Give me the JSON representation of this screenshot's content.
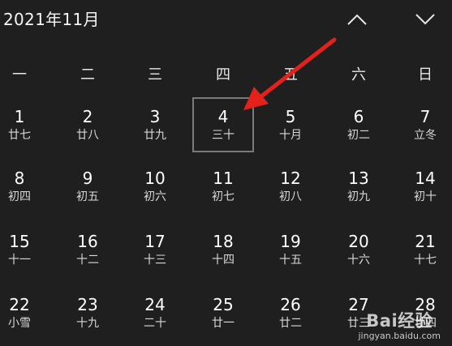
{
  "header": {
    "title": "2021年11月",
    "prev_icon": "chevron-up-icon",
    "next_icon": "chevron-down-icon"
  },
  "weekdays": [
    "一",
    "二",
    "三",
    "四",
    "五",
    "六",
    "日"
  ],
  "days": [
    {
      "solar": "1",
      "lunar": "廿七"
    },
    {
      "solar": "2",
      "lunar": "廿八"
    },
    {
      "solar": "3",
      "lunar": "廿九"
    },
    {
      "solar": "4",
      "lunar": "三十",
      "today": true
    },
    {
      "solar": "5",
      "lunar": "十月"
    },
    {
      "solar": "6",
      "lunar": "初二"
    },
    {
      "solar": "7",
      "lunar": "立冬"
    },
    {
      "solar": "8",
      "lunar": "初四"
    },
    {
      "solar": "9",
      "lunar": "初五"
    },
    {
      "solar": "10",
      "lunar": "初六"
    },
    {
      "solar": "11",
      "lunar": "初七"
    },
    {
      "solar": "12",
      "lunar": "初八"
    },
    {
      "solar": "13",
      "lunar": "初九"
    },
    {
      "solar": "14",
      "lunar": "初十"
    },
    {
      "solar": "15",
      "lunar": "十一"
    },
    {
      "solar": "16",
      "lunar": "十二"
    },
    {
      "solar": "17",
      "lunar": "十三"
    },
    {
      "solar": "18",
      "lunar": "十四"
    },
    {
      "solar": "19",
      "lunar": "十五"
    },
    {
      "solar": "20",
      "lunar": "十六"
    },
    {
      "solar": "21",
      "lunar": "十七"
    },
    {
      "solar": "22",
      "lunar": "小雪"
    },
    {
      "solar": "23",
      "lunar": "十九"
    },
    {
      "solar": "24",
      "lunar": "二十"
    },
    {
      "solar": "25",
      "lunar": "廿一"
    },
    {
      "solar": "26",
      "lunar": "廿二"
    },
    {
      "solar": "27",
      "lunar": "廿三"
    },
    {
      "solar": "28",
      "lunar": "廿四"
    }
  ],
  "annotation": {
    "icon": "red-arrow-icon",
    "color": "#e5211c"
  },
  "colors": {
    "background": "#1f1f1f",
    "today_border": "#7a7a7a"
  },
  "watermark": {
    "logo": "Bai经验",
    "url": "jingyan.baidu.com"
  }
}
